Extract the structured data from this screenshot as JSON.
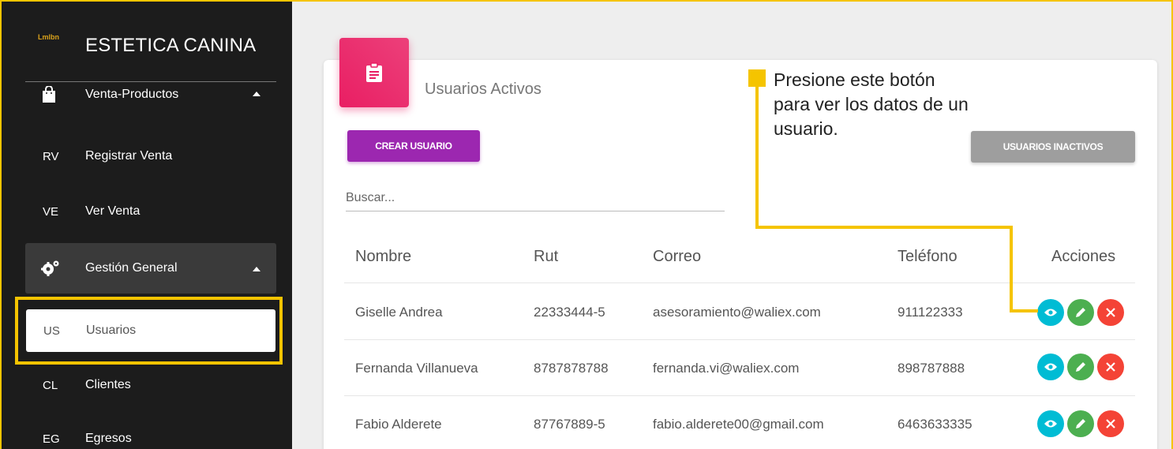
{
  "sidebar": {
    "logo_text": "Lmlbn",
    "brand": "ESTETICA CANINA",
    "sections": [
      {
        "label": "Venta-Productos",
        "icon": "shopping-bag-icon"
      },
      {
        "label": "Gestión General",
        "icon": "gears-icon"
      }
    ],
    "items": [
      {
        "abbr": "RV",
        "label": "Registrar Venta"
      },
      {
        "abbr": "VE",
        "label": "Ver Venta"
      },
      {
        "abbr": "US",
        "label": "Usuarios",
        "selected": true
      },
      {
        "abbr": "CL",
        "label": "Clientes"
      },
      {
        "abbr": "EG",
        "label": "Egresos"
      }
    ]
  },
  "card": {
    "icon": "clipboard-icon",
    "title": "Usuarios Activos",
    "create_button": "CREAR USUARIO",
    "inactive_button": "USUARIOS INACTIVOS",
    "search_placeholder": "Buscar..."
  },
  "table": {
    "headers": [
      "Nombre",
      "Rut",
      "Correo",
      "Teléfono",
      "Acciones"
    ],
    "rows": [
      {
        "nombre": "Giselle Andrea",
        "rut": "22333444-5",
        "correo": "asesoramiento@waliex.com",
        "telefono": "911122333"
      },
      {
        "nombre": "Fernanda Villanueva",
        "rut": "8787878788",
        "correo": "fernanda.vi@waliex.com",
        "telefono": "898787888"
      },
      {
        "nombre": "Fabio Alderete",
        "rut": "87767889-5",
        "correo": "fabio.alderete00@gmail.com",
        "telefono": "6463633335"
      }
    ]
  },
  "callout": {
    "text": "Presione este botón para ver los datos de un usuario."
  },
  "colors": {
    "accent_yellow": "#f5c400",
    "sidebar_bg": "#1c1c1c",
    "create_button": "#9c27b0",
    "inactive_button": "#9e9e9e",
    "card_icon": "#e91e63",
    "view_action": "#00bcd4",
    "edit_action": "#4caf50",
    "delete_action": "#f44336"
  }
}
